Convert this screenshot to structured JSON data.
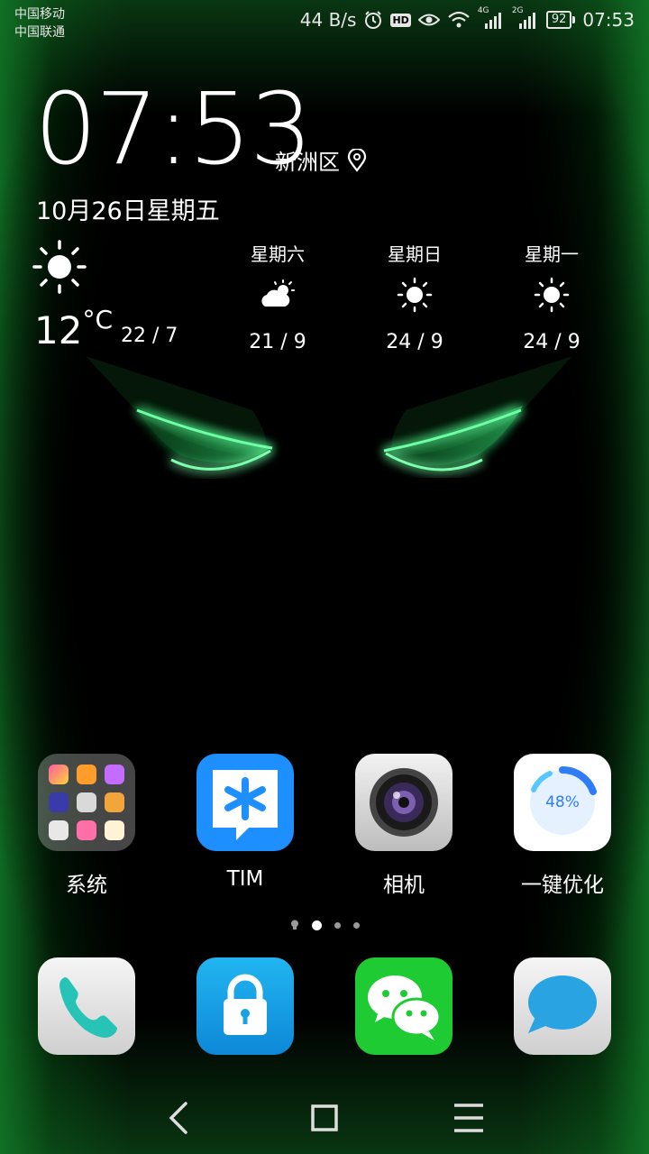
{
  "status_bar": {
    "carrier1": "中国移动",
    "carrier2": "中国联通",
    "net_speed": "44 B/s",
    "net4g": "4G",
    "net2g": "2G",
    "battery": "92",
    "time": "07:53"
  },
  "clock_widget": {
    "time": "07:53",
    "location": "新洲区",
    "date": "10月26日星期五",
    "temperature": "12",
    "unit": "°C",
    "today_range": "22 / 7",
    "forecast": [
      {
        "day": "星期六",
        "icon": "cloudy-sun-icon",
        "range": "21 / 9"
      },
      {
        "day": "星期日",
        "icon": "sun-icon",
        "range": "24 / 9"
      },
      {
        "day": "星期一",
        "icon": "sun-icon",
        "range": "24 / 9"
      }
    ]
  },
  "apps": [
    {
      "label": "系统",
      "icon": "folder-icon"
    },
    {
      "label": "TIM",
      "icon": "tim-icon"
    },
    {
      "label": "相机",
      "icon": "camera-icon"
    },
    {
      "label": "一键优化",
      "icon": "optimize-icon",
      "badge": "48%"
    }
  ],
  "page_indicator": {
    "pages": 3,
    "current": 1
  },
  "dock": [
    {
      "icon": "phone-icon"
    },
    {
      "icon": "lock-icon"
    },
    {
      "icon": "wechat-icon"
    },
    {
      "icon": "message-icon"
    }
  ],
  "colors": {
    "accent": "#2fe86a",
    "tim_blue": "#1e8fff",
    "wechat_green": "#1fcb33",
    "lock_blue": "#1aa2e6"
  }
}
